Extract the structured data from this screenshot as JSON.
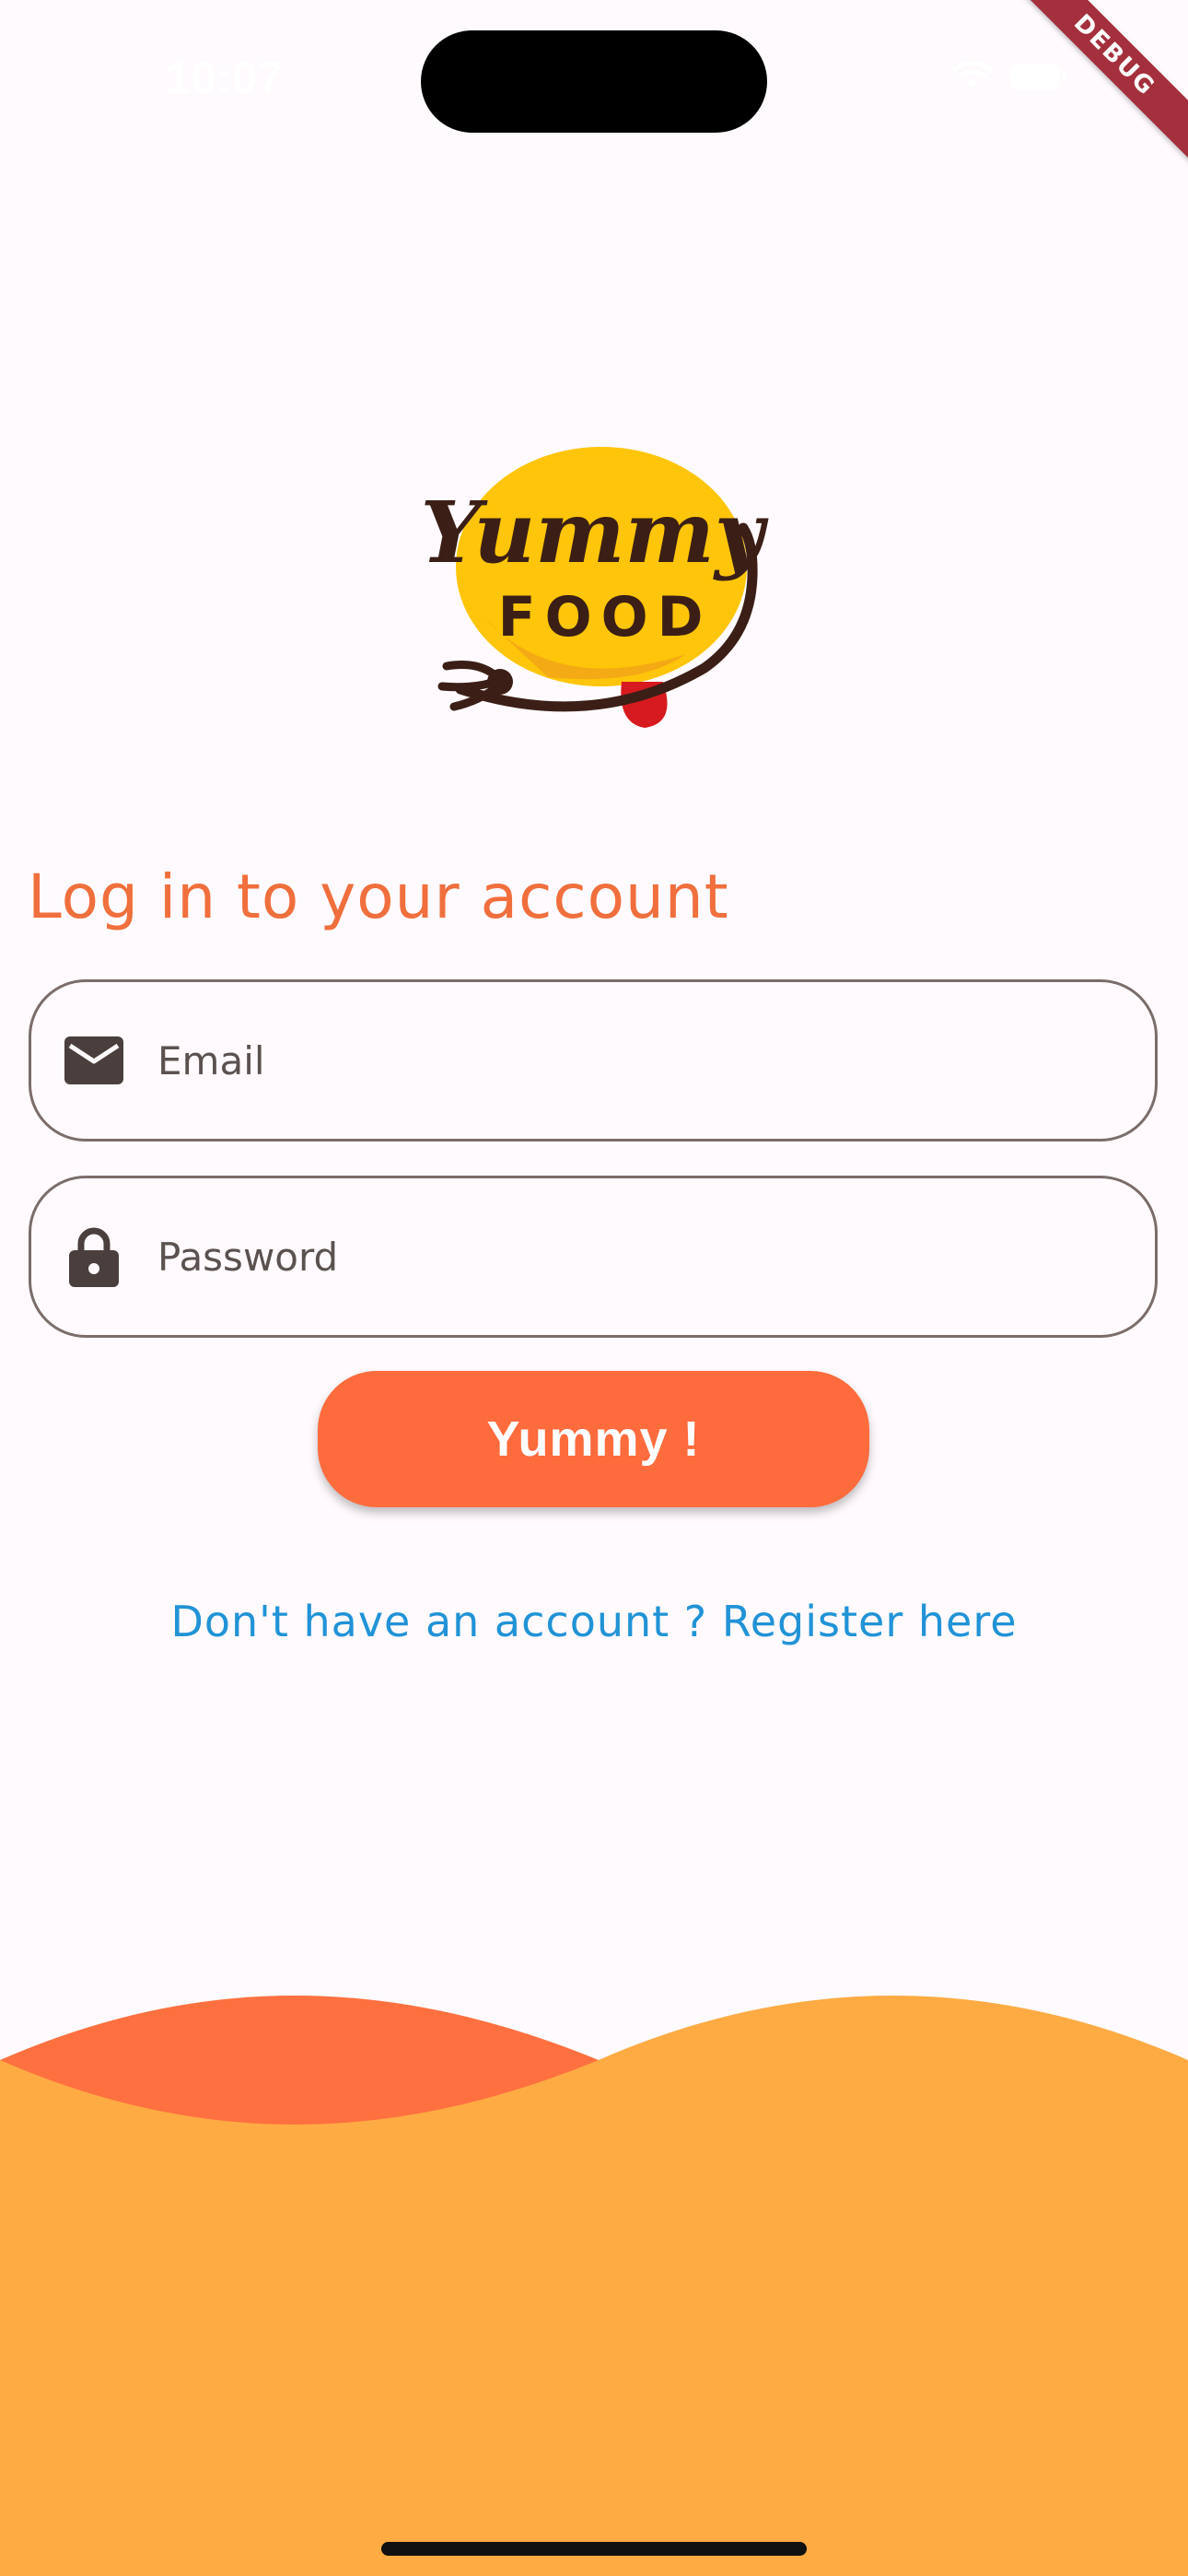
{
  "status_bar": {
    "time": "10:07",
    "debug_label": "DEBUG"
  },
  "logo": {
    "word_top": "Yummy",
    "word_bottom": "FOOD"
  },
  "login": {
    "title": "Log in to your account",
    "email_placeholder": "Email",
    "password_placeholder": "Password",
    "submit_label": "Yummy !",
    "register_link": "Don't have an account ? Register here"
  },
  "icons": {
    "email": "mail-icon",
    "password": "lock-icon"
  },
  "colors": {
    "background": "#fefafd",
    "accent": "#fe6b3d",
    "title": "#f06f3d",
    "link": "#2193d6",
    "wave_back": "#fe7040",
    "wave_front": "#feab44",
    "logo_yellow": "#fec50a",
    "logo_brown": "#3b1f16",
    "logo_red": "#d71a1f"
  }
}
